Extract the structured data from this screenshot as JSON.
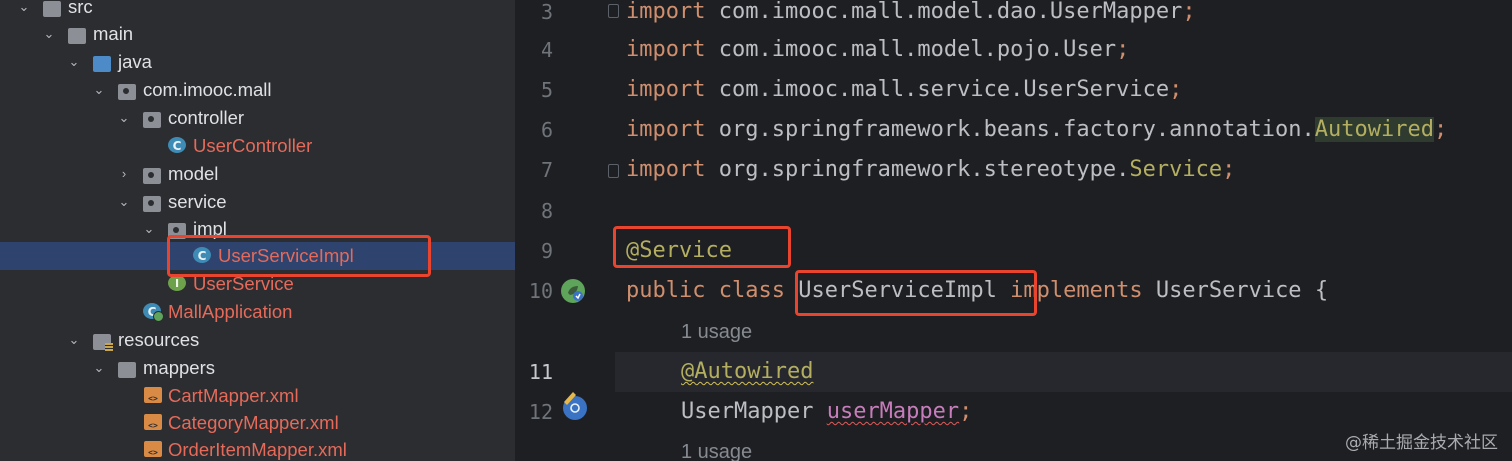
{
  "project_tree": {
    "items": [
      {
        "label": "src",
        "kind": "folder",
        "expanded": true
      },
      {
        "label": "main",
        "kind": "folder",
        "expanded": true
      },
      {
        "label": "java",
        "kind": "source-folder",
        "expanded": true
      },
      {
        "label": "com.imooc.mall",
        "kind": "package",
        "expanded": true
      },
      {
        "label": "controller",
        "kind": "package",
        "expanded": true
      },
      {
        "label": "UserController",
        "kind": "class",
        "icon_letter": "C"
      },
      {
        "label": "model",
        "kind": "package",
        "expanded": false
      },
      {
        "label": "service",
        "kind": "package",
        "expanded": true
      },
      {
        "label": "impl",
        "kind": "package",
        "expanded": true
      },
      {
        "label": "UserServiceImpl",
        "kind": "class",
        "icon_letter": "C",
        "selected": true
      },
      {
        "label": "UserService",
        "kind": "interface",
        "icon_letter": "I"
      },
      {
        "label": "MallApplication",
        "kind": "spring-app"
      },
      {
        "label": "resources",
        "kind": "resources-folder",
        "expanded": true
      },
      {
        "label": "mappers",
        "kind": "folder",
        "expanded": true
      },
      {
        "label": "CartMapper.xml",
        "kind": "xml-file"
      },
      {
        "label": "CategoryMapper.xml",
        "kind": "xml-file"
      },
      {
        "label": "OrderItemMapper.xml",
        "kind": "xml-file"
      }
    ]
  },
  "editor": {
    "line_numbers": [
      "3",
      "4",
      "5",
      "6",
      "7",
      "8",
      "9",
      "10",
      "11",
      "12"
    ],
    "imports": [
      {
        "keyword": "import",
        "path": "com.imooc.mall.model.dao.UserMapper",
        "semi": ";"
      },
      {
        "keyword": "import",
        "path": "com.imooc.mall.model.pojo.User",
        "semi": ";"
      },
      {
        "keyword": "import",
        "path": "com.imooc.mall.service.UserService",
        "semi": ";"
      },
      {
        "keyword": "import",
        "path": "org.springframework.beans.factory.annotation.",
        "highlight": "Autowired",
        "semi": ";"
      },
      {
        "keyword": "import",
        "path": "org.springframework.stereotype.",
        "highlight": "Service",
        "semi": ";"
      }
    ],
    "annotation_service": "@Service",
    "class_decl": {
      "kw_public": "public",
      "kw_class": "class",
      "class_name": "UserServiceImpl",
      "kw_implements": "implements",
      "interface_name": "UserService",
      "brace": "{"
    },
    "usage_hint_1": "1 usage",
    "annotation_autowired": "@Autowired",
    "field_type": "UserMapper",
    "field_name": "userMapper",
    "field_semi": ";",
    "usage_hint_2": "1 usage"
  },
  "watermark": "@稀土掘金技术社区",
  "colors": {
    "callout": "#e8442e",
    "selection": "#2e436e",
    "keyword": "#cf8e6d",
    "annotation": "#b3ae60",
    "field": "#c77dbb"
  }
}
